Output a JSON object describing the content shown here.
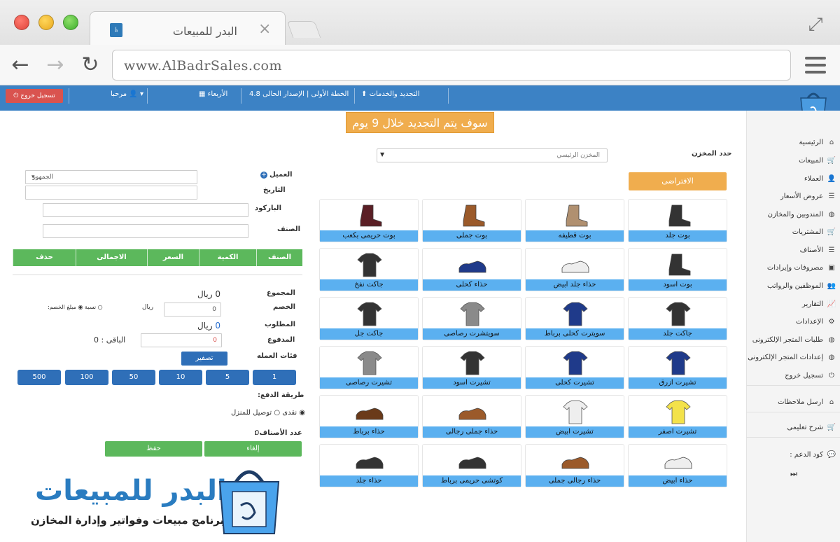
{
  "browser": {
    "tab_title": "البدر للمبيعات",
    "tab_close": "×",
    "url": "www.AlBadrSales.com"
  },
  "topnav": {
    "logout": "تسجيل خروج",
    "greeting": "مرحبا",
    "day": "الأربعاء",
    "version": "الخطة الأولى | الإصدار الحالى 4.8",
    "renewal": "التجديد والخدمات"
  },
  "banner": "سوف يتم التجديد خلال 9 يوم",
  "sidebar": {
    "items": [
      {
        "label": "الرئيسية",
        "icon": "home-icon"
      },
      {
        "label": "المبيعات",
        "icon": "cart-icon"
      },
      {
        "label": "العملاء",
        "icon": "user-icon"
      },
      {
        "label": "عروض الأسعار",
        "icon": "list-icon"
      },
      {
        "label": "المندوبين والمخازن",
        "icon": "globe-icon"
      },
      {
        "label": "المشتريات",
        "icon": "cart-icon"
      },
      {
        "label": "الأصناف",
        "icon": "list-icon"
      },
      {
        "label": "مصروفات وإيرادات",
        "icon": "money-icon"
      },
      {
        "label": "الموظفين والرواتب",
        "icon": "users-icon"
      },
      {
        "label": "التقارير",
        "icon": "chart-icon"
      },
      {
        "label": "الإعدادات",
        "icon": "gear-icon"
      },
      {
        "label": "طلبات المتجر الإلكترونى",
        "icon": "globe-icon"
      },
      {
        "label": "إعدادات المتجر الإلكترونى",
        "icon": "globe-icon"
      },
      {
        "label": "تسجيل خروج",
        "icon": "power-icon"
      },
      {
        "label": "ارسل ملاحظات",
        "icon": "home-icon"
      },
      {
        "label": "شرح تعليمى",
        "icon": "cart-icon"
      }
    ],
    "support_label": "كود الدعم :"
  },
  "store": {
    "label": "حدد المخزن",
    "selected": "المخزن الرئيسي",
    "default_button": "الافتراضى"
  },
  "products": [
    [
      "بوت جلد",
      "بوت قطيفه",
      "بوت جملى",
      "بوت حريمى بكعب"
    ],
    [
      "بوت اسود",
      "حذاء جلد ابيض",
      "حذاء كحلى",
      "جاكت نفخ"
    ],
    [
      "جاكت جلد",
      "سويترت كحلى برباط",
      "سويتشرت رصاصى",
      "جاكت جل"
    ],
    [
      "تشيرت ازرق",
      "تشيرت كحلى",
      "تشيرت اسود",
      "تشيرت رصاصى"
    ],
    [
      "تشيرت اصفر",
      "تشيرت ابيض",
      "حذاء جملى رجالى",
      "حذاء برباط"
    ],
    [
      "حذاء ابيض",
      "حذاء رجالى جملى",
      "كوتشى حريمى برباط",
      "حذاء جلد"
    ]
  ],
  "invoice": {
    "customer_label": "العميل",
    "customer_value": "الجمهور",
    "date_label": "التاريخ",
    "barcode_label": "الباركود",
    "item_label": "الصنف",
    "columns": [
      "الصنف",
      "الكمية",
      "السعر",
      "الاجمالى",
      "حذف"
    ],
    "total_label": "المجموع",
    "total_value": "0",
    "currency": "ريال",
    "discount_label": "الخصم",
    "discount_value": "0",
    "discount_type_label": "الخصم:",
    "discount_fixed": "مبلغ",
    "discount_percent": "نسبة",
    "required_label": "المطلوب",
    "required_value": "0",
    "paid_label": "المدفوع",
    "paid_value": "0",
    "remaining": "الباقى : 0",
    "reset_button": "تصفير",
    "denominations_label": "فئات العمله",
    "denominations": [
      "500",
      "100",
      "50",
      "10",
      "5",
      "1"
    ],
    "payment_label": "طريقة الدفع:",
    "payment_cash": "نقدى",
    "payment_delivery": "توصيل للمنزل",
    "item_count_label": "عدد الأصناف :",
    "item_count_value": "0",
    "cancel_button": "إلغاء",
    "save_button": "حفظ"
  },
  "branding": {
    "title": "البدر للمبيعات",
    "subtitle": "برنامج مبيعات وفواتير وإدارة المخازن"
  },
  "colors": {
    "nav": "#3c82c5",
    "banner": "#f0ad4e",
    "product_label": "#5bb0f0",
    "green": "#5cb85c",
    "money_button": "#2f6fb8",
    "danger": "#d9534f"
  }
}
